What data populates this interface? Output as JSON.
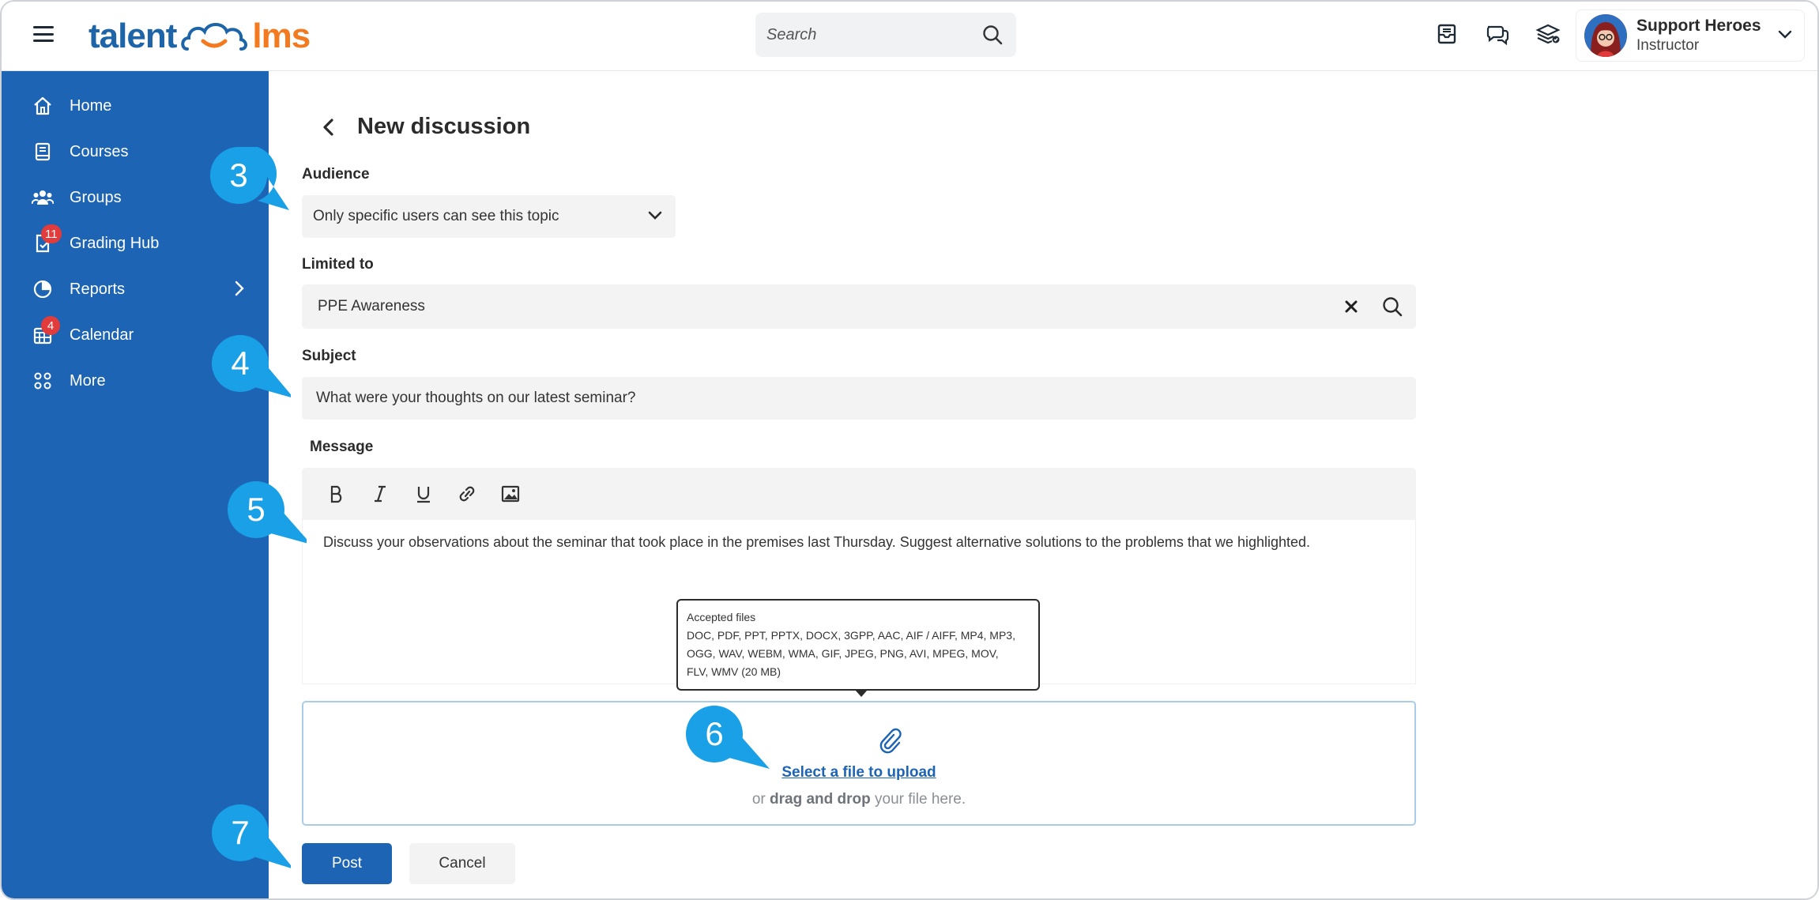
{
  "header": {
    "logo": {
      "part1": "talent",
      "part2": "lms"
    },
    "search": {
      "placeholder": "Search"
    },
    "user": {
      "name": "Support Heroes",
      "role": "Instructor"
    }
  },
  "sidebar": {
    "items": [
      {
        "label": "Home",
        "icon": "home-icon"
      },
      {
        "label": "Courses",
        "icon": "book-icon"
      },
      {
        "label": "Groups",
        "icon": "users-icon"
      },
      {
        "label": "Grading Hub",
        "icon": "grading-icon",
        "badge": "11"
      },
      {
        "label": "Reports",
        "icon": "pie-chart-icon"
      },
      {
        "label": "Calendar",
        "icon": "calendar-icon",
        "badge": "4"
      },
      {
        "label": "More",
        "icon": "grid-icon"
      }
    ]
  },
  "page": {
    "title": "New discussion",
    "audience": {
      "label": "Audience",
      "value": "Only specific users can see this topic"
    },
    "limited": {
      "label": "Limited to",
      "value": "PPE Awareness"
    },
    "subject": {
      "label": "Subject",
      "value": "What were your thoughts on our latest seminar?"
    },
    "message": {
      "label": "Message",
      "value": "Discuss your observations about the seminar that took place in the premises last Thursday. Suggest alternative solutions to the problems that we highlighted."
    },
    "tooltip": {
      "title": "Accepted files",
      "line1": "DOC, PDF, PPT, PPTX, DOCX, 3GPP, AAC, AIF / AIFF, MP4, MP3,",
      "line2": "OGG, WAV, WEBM, WMA, GIF, JPEG, PNG, AVI, MPEG, MOV,",
      "line3": "FLV, WMV (20 MB)"
    },
    "upload": {
      "link": "Select a file to upload",
      "hint_pre": "or ",
      "hint_bold": "drag and drop",
      "hint_post": " your file here."
    },
    "buttons": {
      "post": "Post",
      "cancel": "Cancel"
    }
  },
  "callouts": [
    "3",
    "4",
    "5",
    "6",
    "7"
  ],
  "colors": {
    "brand_blue": "#1d64b4",
    "brand_orange": "#f47a20",
    "callout": "#19a0e6",
    "badge": "#e23b3b"
  }
}
